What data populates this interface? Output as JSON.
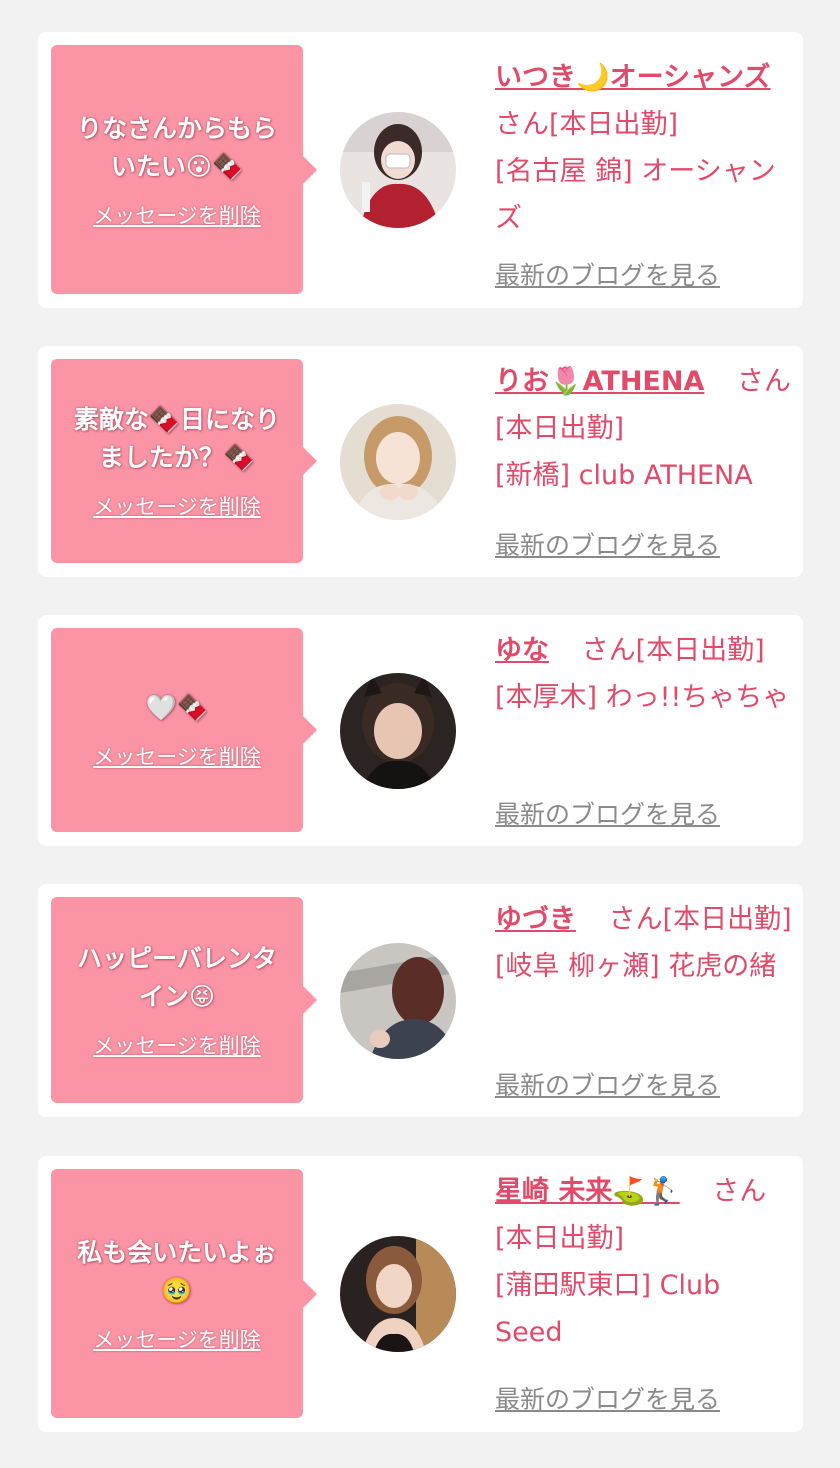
{
  "cards": [
    {
      "message": "りなさんからもらいたい😮🍫",
      "delete_label": "メッセージを削除",
      "name": "いつき🌙オーシャンズ",
      "suffix": "さん[本日出勤]",
      "shop": "[名古屋 錦] オーシャンズ",
      "blog_label": "最新のブログを見る"
    },
    {
      "message": "素敵な🍫日になりましたか？🍫",
      "delete_label": "メッセージを削除",
      "name": "りお🌷ATHENA",
      "suffix": "さん[本日出勤]",
      "shop": "[新橋] club ATHENA",
      "blog_label": "最新のブログを見る"
    },
    {
      "message": "🤍🍫",
      "delete_label": "メッセージを削除",
      "name": "ゆな",
      "suffix": "さん[本日出勤]",
      "shop": "[本厚木] わっ!!ちゃちゃ",
      "blog_label": "最新のブログを見る"
    },
    {
      "message": "ハッピーバレンタイン😝",
      "delete_label": "メッセージを削除",
      "name": "ゆづき",
      "suffix": "さん[本日出勤]",
      "shop": "[岐阜 柳ヶ瀬] 花虎の緒",
      "blog_label": "最新のブログを見る"
    },
    {
      "message": "私も会いたいよぉ🥹",
      "delete_label": "メッセージを削除",
      "name": "星崎 未来⛳🏌",
      "suffix": "さん[本日出勤]",
      "shop": "[蒲田駅東口] Club Seed",
      "blog_label": "最新のブログを見る"
    }
  ]
}
